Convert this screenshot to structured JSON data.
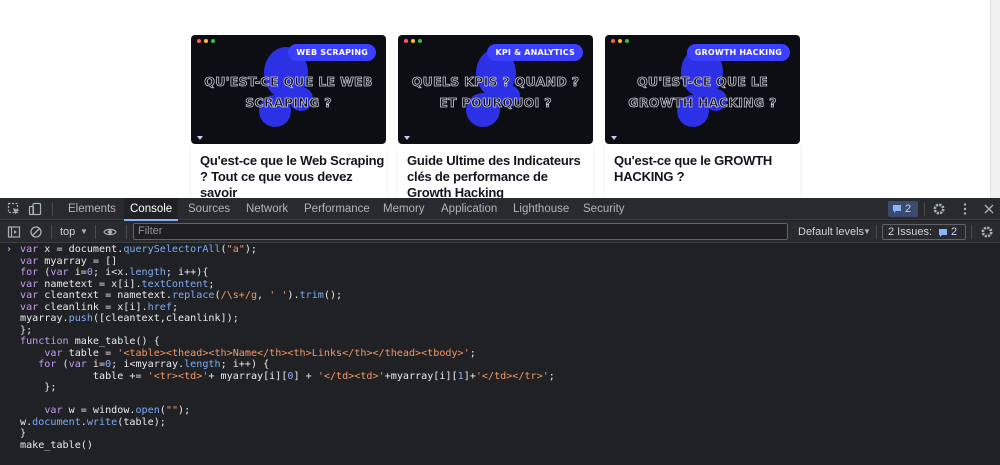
{
  "page": {
    "cards": [
      {
        "badge": "WEB SCRAPING",
        "thumb_title": "QU'EST-CE QUE LE WEB SCRAPING ?",
        "title": "Qu'est-ce que le Web Scraping ? Tout ce que vous devez savoir"
      },
      {
        "badge": "KPI & ANALYTICS",
        "thumb_title": "QUELS KPIS ? QUAND ? ET POURQUOI ?",
        "title": "Guide Ultime des Indicateurs clés de performance de Growth Hacking"
      },
      {
        "badge": "GROWTH HACKING",
        "thumb_title": "QU'EST-CE QUE LE GROWTH HACKING ?",
        "title": "Qu'est-ce que le GROWTH HACKING ?"
      }
    ]
  },
  "devtools": {
    "tabs": [
      "Elements",
      "Console",
      "Sources",
      "Network",
      "Performance",
      "Memory",
      "Application",
      "Lighthouse",
      "Security"
    ],
    "active_tab": "Console",
    "messages_badge": "2",
    "context": "top",
    "filter_placeholder": "Filter",
    "levels": "Default levels",
    "issues_label": "2 Issues:",
    "issues_count": "2"
  },
  "colors": {
    "badge": "#3b3fff",
    "blob": "#2d31e6",
    "devtools_bg": "#202124",
    "accent": "#8ab4f8"
  },
  "console_code": [
    "var x = document.querySelectorAll(\"a\");",
    "var myarray = []",
    "for (var i=0; i<x.length; i++){",
    "var nametext = x[i].textContent;",
    "var cleantext = nametext.replace(/\\s+/g, ' ').trim();",
    "var cleanlink = x[i].href;",
    "myarray.push([cleantext,cleanlink]);",
    "};",
    "function make_table() {",
    "    var table = '<table><thead><th>Name</th><th>Links</th></thead><tbody>';",
    "   for (var i=0; i<myarray.length; i++) {",
    "            table += '<tr><td>'+ myarray[i][0] + '</td><td>'+myarray[i][1]+'</td></tr>';",
    "    };",
    "",
    "    var w = window.open(\"\");",
    "w.document.write(table);",
    "}",
    "make_table()"
  ]
}
